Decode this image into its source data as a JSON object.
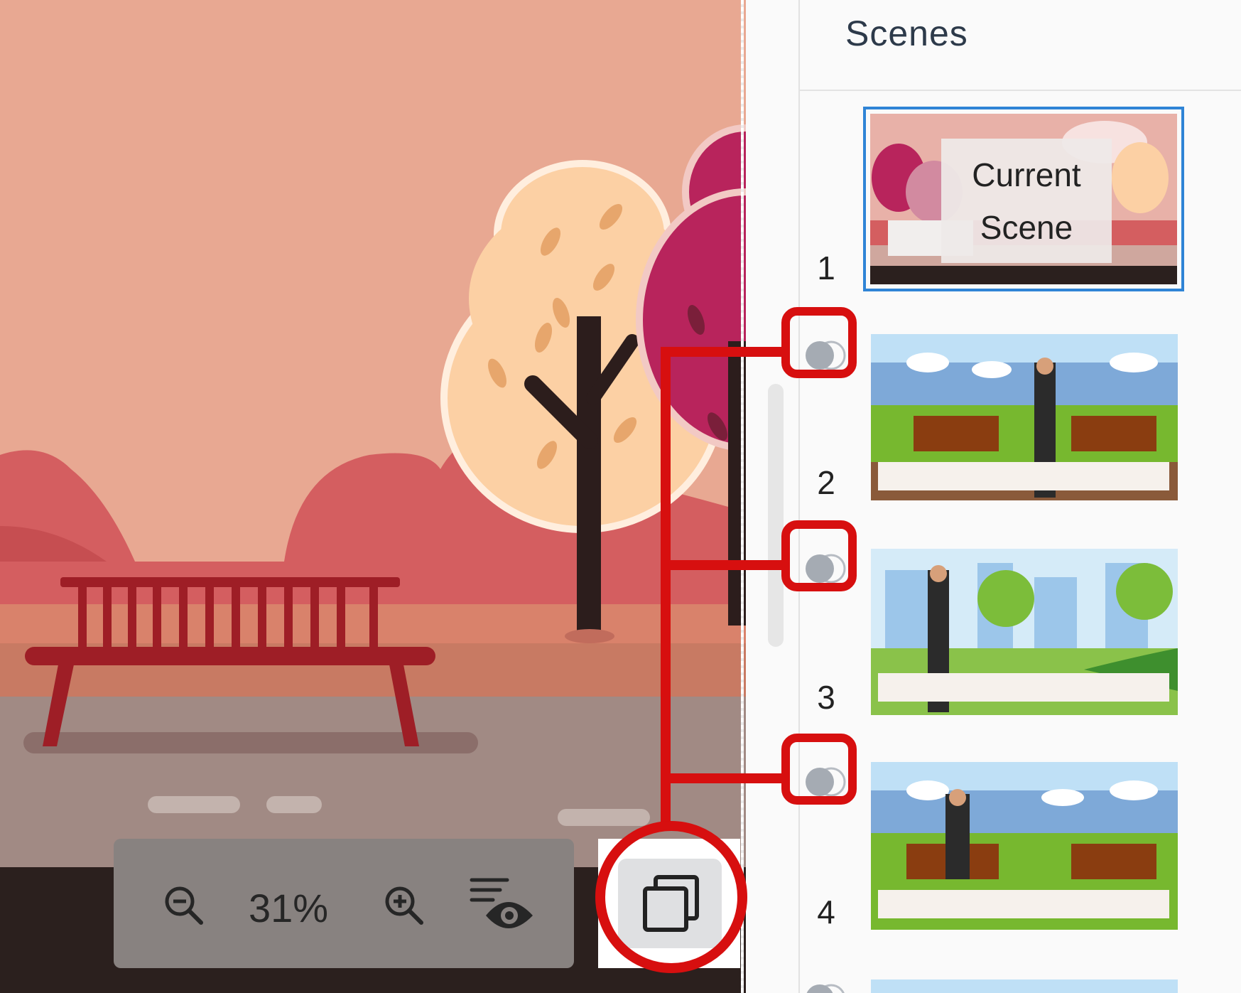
{
  "panel": {
    "title": "Scenes"
  },
  "scenes": [
    {
      "number": "1",
      "selected": true,
      "overlay_line1": "Current",
      "overlay_line2": "Scene"
    },
    {
      "number": "2",
      "selected": false
    },
    {
      "number": "3",
      "selected": false
    },
    {
      "number": "4",
      "selected": false
    }
  ],
  "toolbar": {
    "zoom_out_icon": "zoom-out-icon",
    "zoom_value": "31%",
    "zoom_in_icon": "zoom-in-icon",
    "preview_icon": "preview-eye-icon",
    "copy_icon": "duplicate-scenes-icon"
  },
  "colors": {
    "highlight": "#d70f0f",
    "selected_outline": "#2f84d6",
    "canvas_sky": "#e8a892"
  }
}
